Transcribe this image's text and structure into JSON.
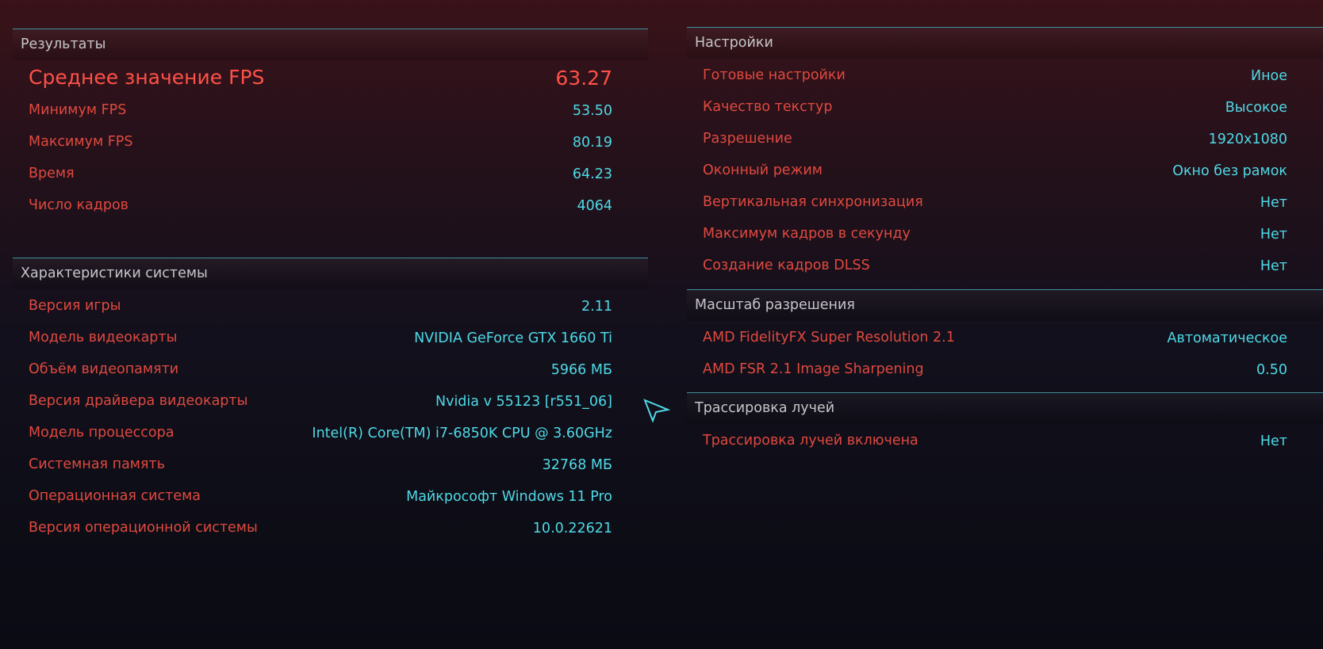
{
  "results": {
    "title": "Результаты",
    "headline": {
      "label": "Среднее значение FPS",
      "value": "63.27"
    },
    "items": [
      {
        "label": "Минимум FPS",
        "value": "53.50"
      },
      {
        "label": "Максимум FPS",
        "value": "80.19"
      },
      {
        "label": "Время",
        "value": "64.23"
      },
      {
        "label": "Число кадров",
        "value": "4064"
      }
    ]
  },
  "system": {
    "title": "Характеристики системы",
    "items": [
      {
        "label": "Версия игры",
        "value": "2.11"
      },
      {
        "label": "Модель видеокарты",
        "value": "NVIDIA GeForce GTX 1660 Ti"
      },
      {
        "label": "Объём видеопамяти",
        "value": "5966 МБ"
      },
      {
        "label": "Версия драйвера видеокарты",
        "value": "Nvidia v 55123 [r551_06]"
      },
      {
        "label": "Модель процессора",
        "value": "Intel(R) Core(TM) i7-6850K CPU @ 3.60GHz"
      },
      {
        "label": "Системная память",
        "value": "32768 МБ"
      },
      {
        "label": "Операционная система",
        "value": "Майкрософт Windows 11 Pro"
      },
      {
        "label": "Версия операционной системы",
        "value": "10.0.22621"
      }
    ]
  },
  "settings": {
    "title": "Настройки",
    "items": [
      {
        "label": "Готовые настройки",
        "value": "Иное"
      },
      {
        "label": "Качество текстур",
        "value": "Высокое"
      },
      {
        "label": "Разрешение",
        "value": "1920x1080"
      },
      {
        "label": "Оконный режим",
        "value": "Окно без рамок"
      },
      {
        "label": "Вертикальная синхронизация",
        "value": "Нет"
      },
      {
        "label": "Максимум кадров в секунду",
        "value": "Нет"
      },
      {
        "label": "Создание кадров DLSS",
        "value": "Нет"
      }
    ]
  },
  "scaling": {
    "title": "Масштаб разрешения",
    "items": [
      {
        "label": "AMD FidelityFX Super Resolution 2.1",
        "value": "Автоматическое"
      },
      {
        "label": "AMD FSR 2.1 Image Sharpening",
        "value": "0.50"
      }
    ]
  },
  "raytracing": {
    "title": "Трассировка лучей",
    "items": [
      {
        "label": "Трассировка лучей включена",
        "value": "Нет"
      }
    ]
  },
  "icons": {
    "cursor": "cursor-arrow-icon"
  },
  "colors": {
    "label_red": "#e0493f",
    "headline_red": "#ff5147",
    "value_cyan": "#4fd9e6",
    "divider_teal": "#3f8f9a",
    "header_text": "#c5c6c8"
  }
}
